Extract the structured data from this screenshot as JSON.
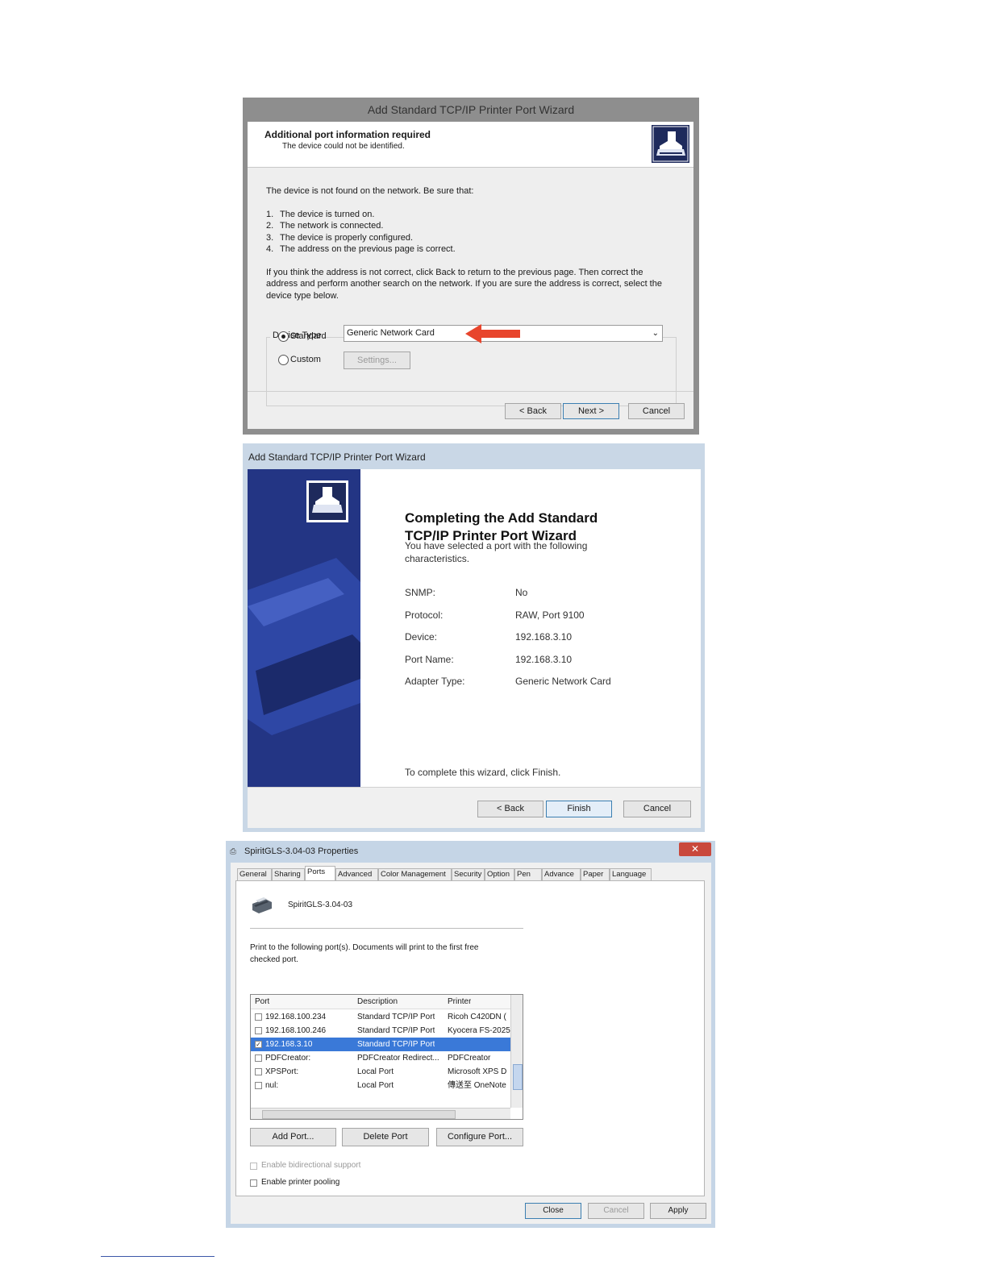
{
  "wizard1": {
    "title": "Add Standard TCP/IP Printer Port Wizard",
    "header_title": "Additional port information required",
    "header_subtitle": "The device could not be identified.",
    "intro": "The device is not found on the network.  Be sure that:",
    "checklist": [
      {
        "num": "1.",
        "text": "The device is turned on."
      },
      {
        "num": "2.",
        "text": "The network is connected."
      },
      {
        "num": "3.",
        "text": "The device is properly configured."
      },
      {
        "num": "4.",
        "text": "The address on the previous page is correct."
      }
    ],
    "advice_line1": "If you think the address is not correct, click Back to return to the previous page.  Then correct the",
    "advice_line2": "address and perform another search on the network.  If you are sure the address is correct, select the",
    "advice_line3": "device type below.",
    "group_label": "Device Type",
    "standard_label": "Standard",
    "custom_label": "Custom",
    "device_type_value": "Generic Network Card",
    "settings_button": "Settings...",
    "back_button": "< Back",
    "next_button": "Next >",
    "cancel_button": "Cancel",
    "arrow_color": "#e8452c"
  },
  "wizard2": {
    "title": "Add Standard TCP/IP Printer Port Wizard",
    "heading_line1": "Completing the Add Standard",
    "heading_line2": "TCP/IP Printer Port Wizard",
    "intro_line1": "You have selected a port with the following",
    "intro_line2": "characteristics.",
    "fields": [
      {
        "label": "SNMP:",
        "value": "No"
      },
      {
        "label": "Protocol:",
        "value": "RAW, Port 9100"
      },
      {
        "label": "Device:",
        "value": "192.168.3.10"
      },
      {
        "label": "Port Name:",
        "value": "192.168.3.10"
      },
      {
        "label": "Adapter Type:",
        "value": "Generic Network Card"
      }
    ],
    "finish_note": "To complete this wizard, click Finish.",
    "back_button": "< Back",
    "finish_button": "Finish",
    "cancel_button": "Cancel",
    "banner_color": "#233584"
  },
  "props": {
    "title": "SpiritGLS-3.04-03 Properties",
    "tabs": [
      "General",
      "Sharing",
      "Ports",
      "Advanced",
      "Color Management",
      "Security",
      "Option",
      "Pen",
      "Advance",
      "Paper",
      "Language"
    ],
    "active_tab": "Ports",
    "printer_name": "SpiritGLS-3.04-03",
    "instructions_line1": "Print to the following port(s). Documents will print to the first free",
    "instructions_line2": "checked port.",
    "columns": [
      "Port",
      "Description",
      "Printer"
    ],
    "rows": [
      {
        "port": "192.168.100.234",
        "description": "Standard TCP/IP Port",
        "printer": "Ricoh C420DN (",
        "checked": false,
        "selected": false
      },
      {
        "port": "192.168.100.246",
        "description": "Standard TCP/IP Port",
        "printer": "Kyocera FS-2025",
        "checked": false,
        "selected": false
      },
      {
        "port": "192.168.3.10",
        "description": "Standard TCP/IP Port",
        "printer": "",
        "checked": true,
        "selected": true
      },
      {
        "port": "PDFCreator:",
        "description": "PDFCreator Redirect...",
        "printer": "PDFCreator",
        "checked": false,
        "selected": false
      },
      {
        "port": "XPSPort:",
        "description": "Local Port",
        "printer": "Microsoft XPS D",
        "checked": false,
        "selected": false
      },
      {
        "port": "nul:",
        "description": "Local Port",
        "printer": "傳送至 OneNote",
        "checked": false,
        "selected": false
      }
    ],
    "add_port_button": "Add Port...",
    "delete_port_button": "Delete Port",
    "configure_port_button": "Configure Port...",
    "bidirectional_label": "Enable bidirectional support",
    "pooling_label": "Enable printer pooling",
    "close_button": "Close",
    "cancel_button": "Cancel",
    "apply_button": "Apply",
    "selection_color": "#3a79d8"
  }
}
